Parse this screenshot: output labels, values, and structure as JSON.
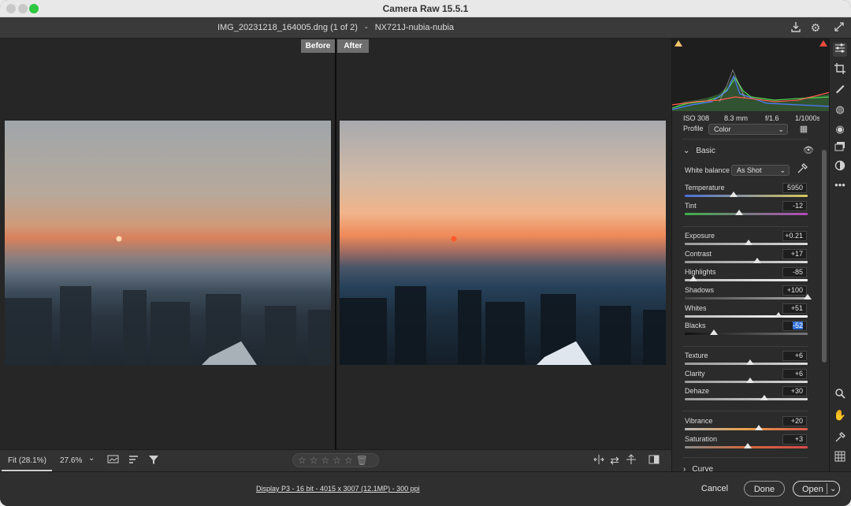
{
  "window": {
    "title": "Camera Raw 15.5.1"
  },
  "file": {
    "name": "IMG_20231218_164005.dng (1 of 2)",
    "sep": "-",
    "camera": "NX721J-nubia-nubia"
  },
  "compare": {
    "before": "Before",
    "after": "After"
  },
  "status": {
    "fit": "Fit (28.1%)",
    "zoom": "27.6%",
    "zoom_caret": "⌄",
    "stars": "☆☆☆☆☆"
  },
  "footer": {
    "info": "Display P3 - 16 bit - 4015 x 3007 (12.1MP) - 300 ppi",
    "cancel": "Cancel",
    "done": "Done",
    "open": "Open"
  },
  "exif": {
    "iso": "ISO 308",
    "focal": "8.3 mm",
    "aperture": "f/1.6",
    "shutter": "1/1000s"
  },
  "profile": {
    "label": "Profile",
    "value": "Color"
  },
  "basic": {
    "title": "Basic",
    "wb_label": "White balance",
    "wb_value": "As Shot",
    "sliders": [
      {
        "label": "Temperature",
        "value": "5950",
        "level": 0.4
      },
      {
        "label": "Tint",
        "value": "-12",
        "level": 0.44
      },
      {
        "label": "Exposure",
        "value": "+0.21",
        "level": 0.52
      },
      {
        "label": "Contrast",
        "value": "+17",
        "level": 0.59
      },
      {
        "label": "Highlights",
        "value": "-85",
        "level": 0.07
      },
      {
        "label": "Shadows",
        "value": "+100",
        "level": 1.0
      },
      {
        "label": "Whites",
        "value": "+51",
        "level": 0.76
      },
      {
        "label": "Blacks",
        "value": "-52",
        "level": 0.24
      },
      {
        "label": "Texture",
        "value": "+6",
        "level": 0.53
      },
      {
        "label": "Clarity",
        "value": "+6",
        "level": 0.53
      },
      {
        "label": "Dehaze",
        "value": "+30",
        "level": 0.65
      },
      {
        "label": "Vibrance",
        "value": "+20",
        "level": 0.6
      },
      {
        "label": "Saturation",
        "value": "+3",
        "level": 0.51
      }
    ]
  },
  "curve": {
    "title": "Curve"
  }
}
